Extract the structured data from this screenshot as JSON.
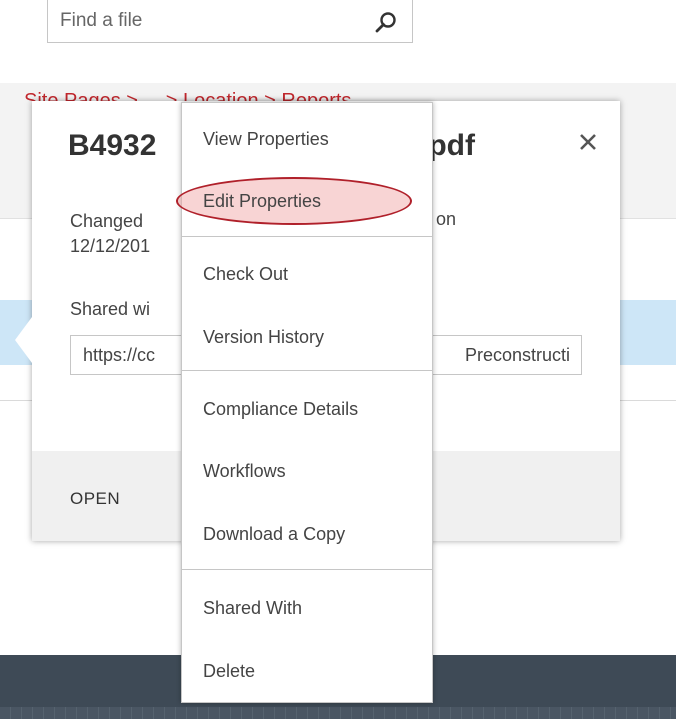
{
  "search": {
    "placeholder": "Find a file",
    "icon": "search-icon"
  },
  "background": {
    "red_text": "Site Pages > ... > Location > Reports",
    "accent_color": "#c1272d",
    "selected_row_color": "#cde6f7",
    "footer_color": "#3e4a56"
  },
  "callout": {
    "title_start": "B4932",
    "title_end": "f.pdf",
    "changed_line1": "Changed",
    "changed_line1_end": "on",
    "changed_line2": "12/12/201",
    "shared_text": "Shared wi",
    "link_start": "https://cc",
    "link_end": "Preconstructi",
    "open_label": "OPEN",
    "close_icon": "close-icon"
  },
  "context_menu": {
    "items": [
      {
        "label": "View Properties"
      },
      {
        "label": "Edit Properties",
        "highlighted": true
      },
      {
        "label": "Check Out"
      },
      {
        "label": "Version History"
      },
      {
        "label": "Compliance Details"
      },
      {
        "label": "Workflows"
      },
      {
        "label": "Download a Copy"
      },
      {
        "label": "Shared With"
      },
      {
        "label": "Delete"
      }
    ],
    "highlight_color": "#b0202a"
  }
}
